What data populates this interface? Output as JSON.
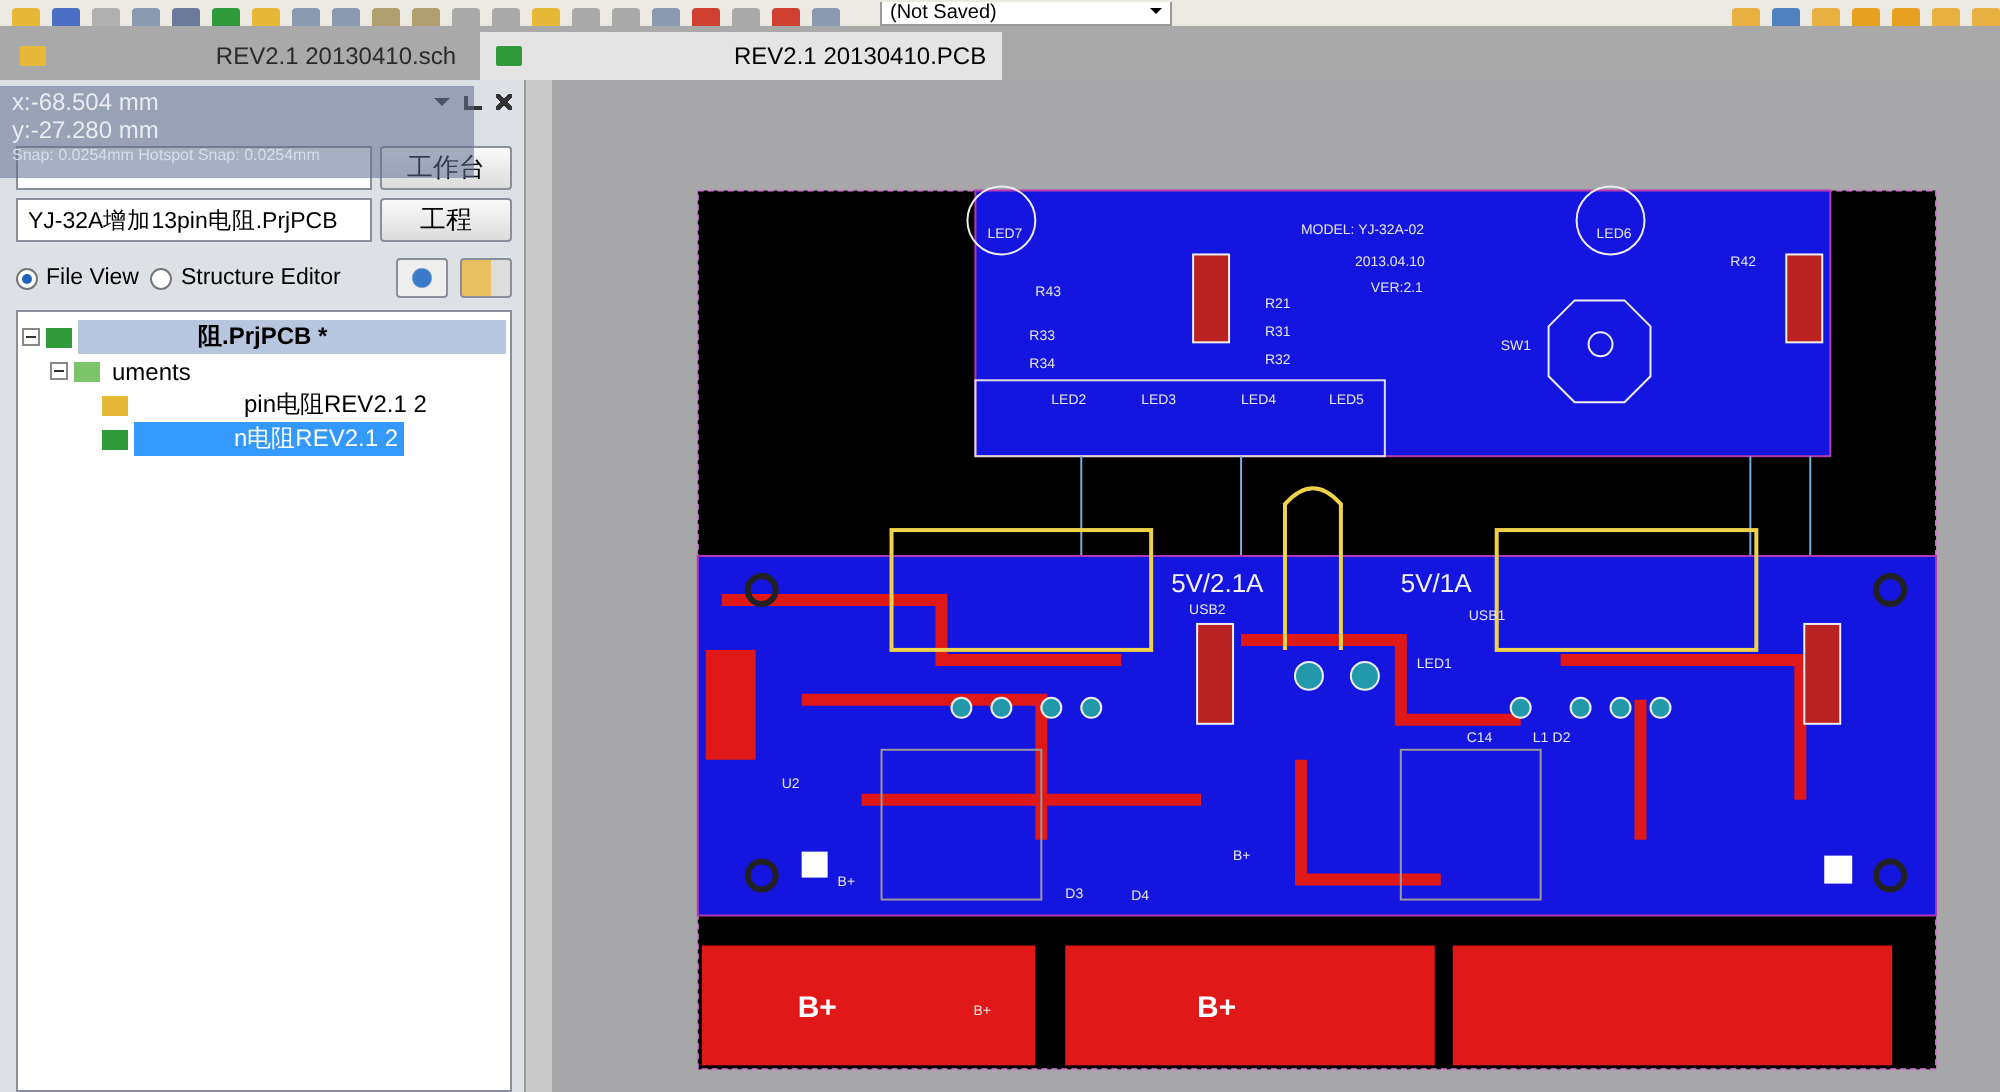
{
  "toolbar": {
    "configuration": "(Not Saved)"
  },
  "tabs": [
    {
      "label": "REV2.1 20130410.sch",
      "kind": "sch",
      "selected": false
    },
    {
      "label": "REV2.1 20130410.PCB",
      "kind": "pcb",
      "selected": true
    }
  ],
  "panel": {
    "workspace_button": "工作台",
    "project_button": "工程",
    "project_field": "YJ-32A增加13pin电阻.PrjPCB",
    "views": [
      {
        "label": "File View",
        "selected": true
      },
      {
        "label": "Structure Editor",
        "selected": false
      }
    ],
    "tree": [
      {
        "label": "阻.PrjPCB *",
        "kind": "project",
        "selected": true,
        "expanded": true,
        "children": [
          {
            "label": "uments",
            "kind": "folder",
            "selected": false,
            "expanded": true,
            "children": [
              {
                "label": "pin电阻REV2.1 2",
                "kind": "sch",
                "selected": false
              },
              {
                "label": "n电阻REV2.1 2",
                "kind": "pcb",
                "selected": true
              }
            ]
          }
        ]
      }
    ]
  },
  "cursor_info": {
    "x": "x:-68.504 mm",
    "y": "y:-27.280 mm",
    "snap": "Snap: 0.0254mm Hotspot Snap: 0.0254mm"
  },
  "pcb": {
    "labels": [
      {
        "text": "MODEL: YJ-32A-02",
        "kind": "small"
      },
      {
        "text": "2013.04.10",
        "kind": "small"
      },
      {
        "text": "VER:2.1",
        "kind": "small"
      },
      {
        "text": "LED7",
        "kind": "small"
      },
      {
        "text": "LED6",
        "kind": "small"
      },
      {
        "text": "R43",
        "kind": "small"
      },
      {
        "text": "R33",
        "kind": "small"
      },
      {
        "text": "R34",
        "kind": "small"
      },
      {
        "text": "R21",
        "kind": "small"
      },
      {
        "text": "R31",
        "kind": "small"
      },
      {
        "text": "R32",
        "kind": "small"
      },
      {
        "text": "R42",
        "kind": "small"
      },
      {
        "text": "SW1",
        "kind": "small"
      },
      {
        "text": "LED2",
        "kind": "small"
      },
      {
        "text": "LED3",
        "kind": "small"
      },
      {
        "text": "LED4",
        "kind": "small"
      },
      {
        "text": "LED5",
        "kind": "small"
      },
      {
        "text": "5V/2.1A",
        "kind": "large"
      },
      {
        "text": "5V/1A",
        "kind": "large"
      },
      {
        "text": "USB2",
        "kind": "small"
      },
      {
        "text": "USB1",
        "kind": "small"
      },
      {
        "text": "LED1",
        "kind": "small"
      },
      {
        "text": "C14",
        "kind": "small"
      },
      {
        "text": "L1",
        "kind": "small"
      },
      {
        "text": "D2",
        "kind": "small"
      },
      {
        "text": "D3",
        "kind": "small"
      },
      {
        "text": "D4",
        "kind": "small"
      },
      {
        "text": "U2",
        "kind": "small"
      },
      {
        "text": "B+",
        "kind": "small"
      },
      {
        "text": "B+",
        "kind": "small"
      },
      {
        "text": "B+",
        "kind": "pad"
      },
      {
        "text": "B+",
        "kind": "small"
      },
      {
        "text": "B+",
        "kind": "pad"
      }
    ]
  }
}
